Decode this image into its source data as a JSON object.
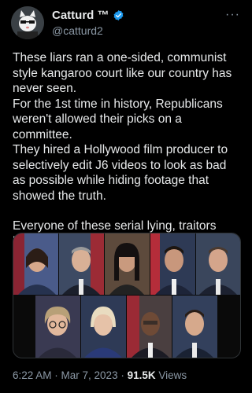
{
  "account": {
    "display_name": "Catturd ™",
    "handle": "@catturd2",
    "verified": true,
    "verified_color": "#1d9bf0",
    "avatar_icon": "cartoon-cat-avatar"
  },
  "more_icon": "more-horizontal-icon",
  "tweet": {
    "lines": [
      "These liars ran a one-sided, communist style kangaroo court like our country has never seen.",
      "For the 1st time in history, Republicans weren't allowed their picks on a committee.",
      "They hired a Hollywood film producer to selectively edit J6 videos to look as bad as possible while hiding footage that showed the truth.",
      "",
      "Everyone of these serial lying, traitors belong in prison."
    ]
  },
  "media": {
    "type": "photo-collage",
    "photo_count": 9
  },
  "footer": {
    "time": "6:22 AM",
    "sep1": " · ",
    "date": "Mar 7, 2023",
    "sep2": " · ",
    "views_count": "91.5K",
    "views_label": " Views"
  }
}
